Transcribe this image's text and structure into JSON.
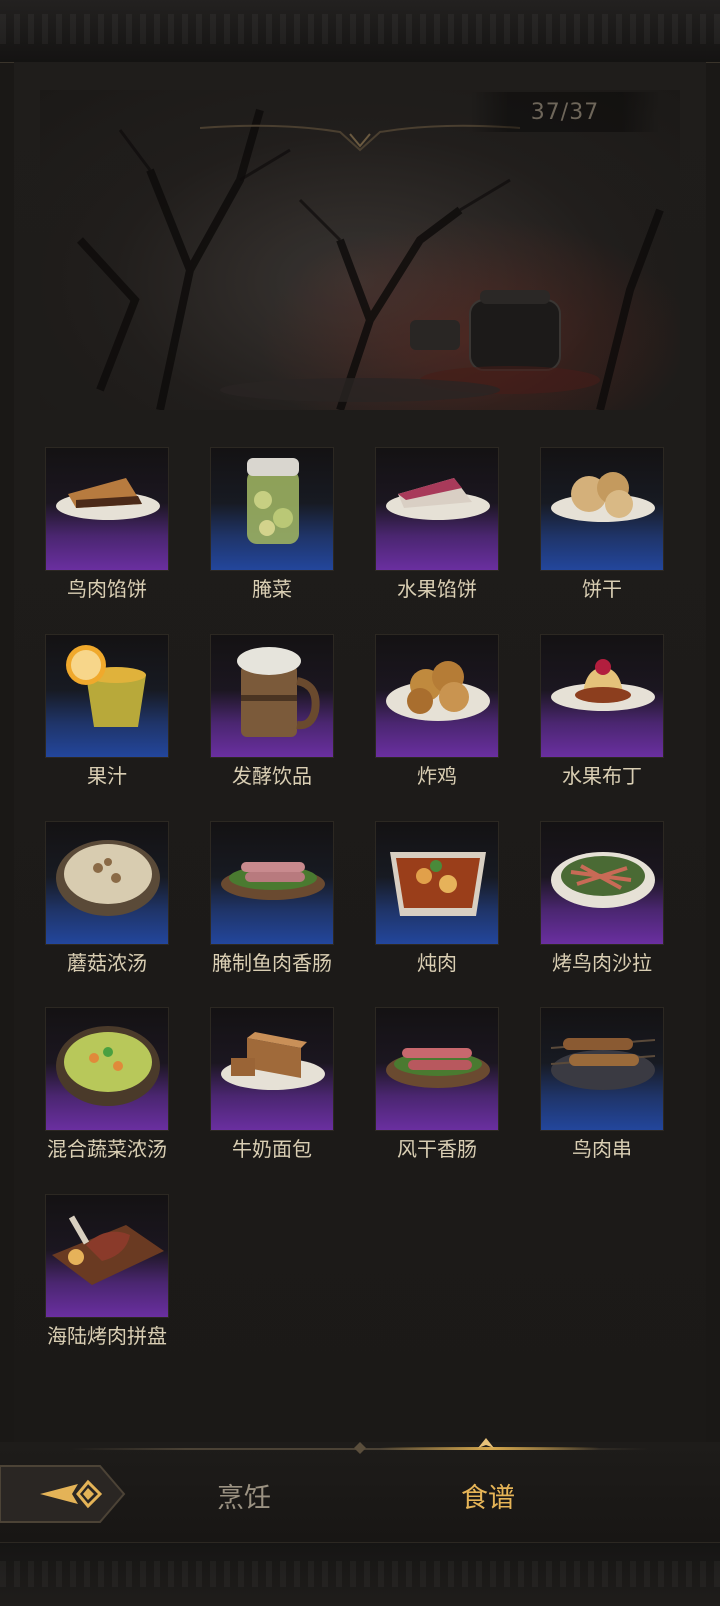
{
  "counter": "37/37",
  "recipes": [
    {
      "name": "鸟肉馅饼",
      "rarity": "purple",
      "icon": "meat-pie-icon"
    },
    {
      "name": "腌菜",
      "rarity": "blue",
      "icon": "pickle-jar-icon"
    },
    {
      "name": "水果馅饼",
      "rarity": "purple",
      "icon": "fruit-pie-icon"
    },
    {
      "name": "饼干",
      "rarity": "blue",
      "icon": "biscuit-icon"
    },
    {
      "name": "果汁",
      "rarity": "blue",
      "icon": "juice-icon"
    },
    {
      "name": "发酵饮品",
      "rarity": "purple",
      "icon": "beer-mug-icon"
    },
    {
      "name": "炸鸡",
      "rarity": "purple",
      "icon": "fried-chicken-icon"
    },
    {
      "name": "水果布丁",
      "rarity": "purple",
      "icon": "pudding-icon"
    },
    {
      "name": "蘑菇浓汤",
      "rarity": "blue",
      "icon": "mushroom-soup-icon"
    },
    {
      "name": "腌制鱼肉香肠",
      "rarity": "blue",
      "icon": "fish-sausage-icon"
    },
    {
      "name": "炖肉",
      "rarity": "blue",
      "icon": "stew-icon"
    },
    {
      "name": "烤鸟肉沙拉",
      "rarity": "purple",
      "icon": "salad-icon"
    },
    {
      "name": "混合蔬菜浓汤",
      "rarity": "purple",
      "icon": "veggie-soup-icon"
    },
    {
      "name": "牛奶面包",
      "rarity": "purple",
      "icon": "milk-bread-icon"
    },
    {
      "name": "风干香肠",
      "rarity": "purple",
      "icon": "dried-sausage-icon"
    },
    {
      "name": "鸟肉串",
      "rarity": "blue",
      "icon": "skewer-icon"
    },
    {
      "name": "海陆烤肉拼盘",
      "rarity": "purple",
      "icon": "grill-platter-icon"
    }
  ],
  "tabs": {
    "cook": "烹饪",
    "recipe": "食谱",
    "active": "recipe"
  },
  "colors": {
    "purple": "#6a2fa0",
    "blue": "#23469c",
    "active_tab": "#e5b457"
  }
}
